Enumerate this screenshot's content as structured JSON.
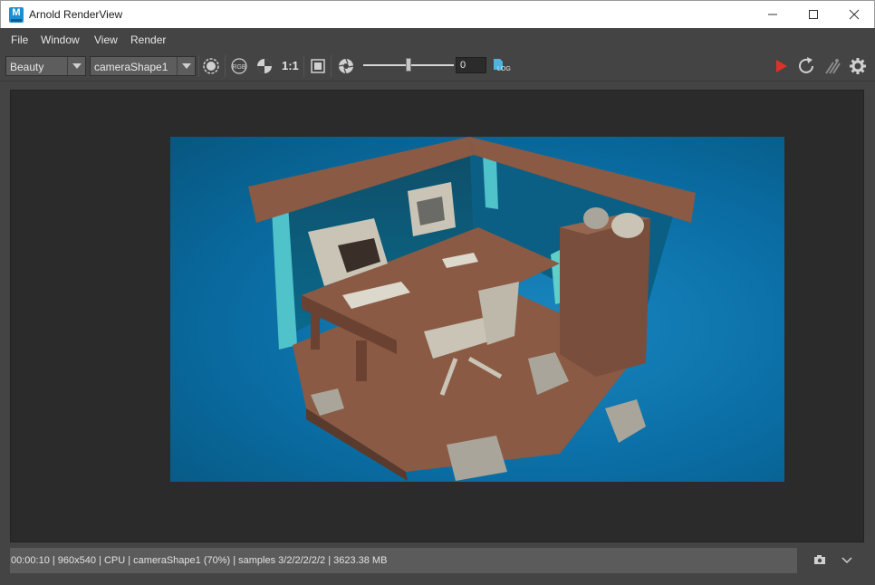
{
  "window": {
    "title": "Arnold RenderView",
    "app_icon_letter": "M"
  },
  "menu": {
    "items": [
      "File",
      "Window",
      "View",
      "Render"
    ]
  },
  "toolbar": {
    "aov_select": "Beauty",
    "camera_select": "cameraShape1",
    "ratio_label": "1:1",
    "exposure_value": "0",
    "exposure_level": 0.5,
    "log_label": "LOG",
    "rgb_label": "RGB"
  },
  "status": {
    "text": "00:00:10 | 960x540 | CPU | cameraShape1 (70%) | samples 3/2/2/2/2/2 | 3623.38 MB"
  },
  "colors": {
    "render_bg": "#0a6da4",
    "wood": "#8a5a44",
    "monitor": "#c9c4b5",
    "wall_accent": "#4fc3c9",
    "render_button": "#d9342b"
  }
}
